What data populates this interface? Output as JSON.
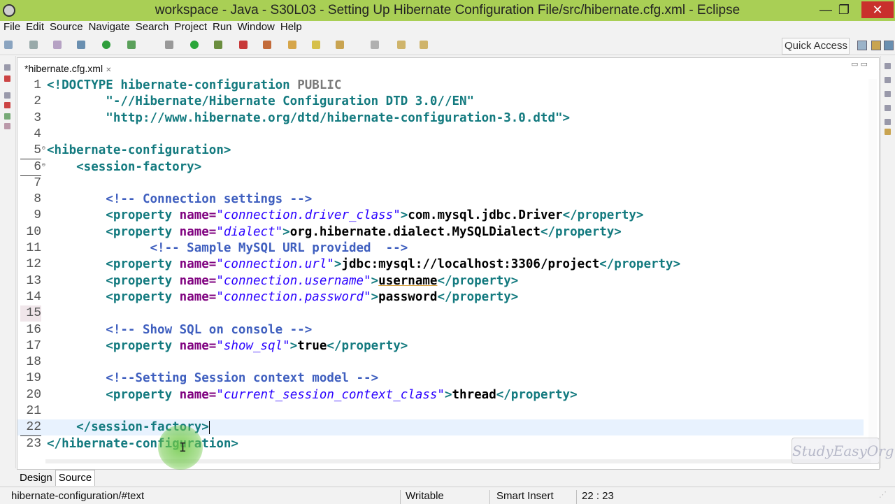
{
  "window": {
    "title": "workspace - Java - S30L03 - Setting Up Hibernate Configuration File/src/hibernate.cfg.xml - Eclipse",
    "minimize": "—",
    "maximize": "❐",
    "close": "✕"
  },
  "menu": [
    "File",
    "Edit",
    "Source",
    "Navigate",
    "Search",
    "Project",
    "Run",
    "Window",
    "Help"
  ],
  "toolbar": {
    "quick_access": "Quick Access"
  },
  "editor": {
    "tab_label": "*hibernate.cfg.xml",
    "tab_close": "✕",
    "min_max": "▭ ▭"
  },
  "lines": [
    {
      "num": "1",
      "t": [
        [
          "c-doc",
          "<!DOCTYPE hibernate-configuration "
        ],
        [
          "c-pub",
          "PUBLIC"
        ]
      ]
    },
    {
      "num": "2",
      "t": [
        [
          "c-str",
          "        \"-//Hibernate/Hibernate Configuration DTD 3.0//EN\""
        ]
      ]
    },
    {
      "num": "3",
      "t": [
        [
          "c-str",
          "        \"http://www.hibernate.org/dtd/hibernate-configuration-3.0.dtd\">"
        ]
      ]
    },
    {
      "num": "4",
      "t": []
    },
    {
      "num": "5",
      "t": [
        [
          "c-tag",
          "<hibernate-configuration>"
        ]
      ]
    },
    {
      "num": "6",
      "t": [
        [
          "c-tag",
          "    <session-factory>"
        ]
      ]
    },
    {
      "num": "7",
      "t": []
    },
    {
      "num": "8",
      "t": [
        [
          "c-com",
          "        <!-- Connection settings -->"
        ]
      ]
    },
    {
      "num": "9",
      "t": [
        [
          "c-tag",
          "        <property "
        ],
        [
          "c-attr",
          "name="
        ],
        [
          "c-val",
          "\"connection.driver_class\""
        ],
        [
          "c-tag",
          ">"
        ],
        [
          "c-text",
          "com.mysql.jdbc.Driver"
        ],
        [
          "c-tag",
          "</property>"
        ]
      ]
    },
    {
      "num": "10",
      "t": [
        [
          "c-tag",
          "        <property "
        ],
        [
          "c-attr",
          "name="
        ],
        [
          "c-val",
          "\"dialect\""
        ],
        [
          "c-tag",
          ">"
        ],
        [
          "c-text",
          "org.hibernate.dialect.MySQLDialect"
        ],
        [
          "c-tag",
          "</property>"
        ]
      ]
    },
    {
      "num": "11",
      "t": [
        [
          "c-com",
          "              <!-- Sample MySQL URL provided  -->"
        ]
      ]
    },
    {
      "num": "12",
      "t": [
        [
          "c-tag",
          "        <property "
        ],
        [
          "c-attr",
          "name="
        ],
        [
          "c-val",
          "\"connection.url\""
        ],
        [
          "c-tag",
          ">"
        ],
        [
          "c-text",
          "jdbc:mysql://localhost:3306/project"
        ],
        [
          "c-tag",
          "</property>"
        ]
      ]
    },
    {
      "num": "13",
      "t": [
        [
          "c-tag",
          "        <property "
        ],
        [
          "c-attr",
          "name="
        ],
        [
          "c-val",
          "\"connection.username\""
        ],
        [
          "c-tag",
          ">"
        ],
        [
          "c-text",
          "username"
        ],
        [
          "c-tag",
          "</property>"
        ]
      ]
    },
    {
      "num": "14",
      "t": [
        [
          "c-tag",
          "        <property "
        ],
        [
          "c-attr",
          "name="
        ],
        [
          "c-val",
          "\"connection.password\""
        ],
        [
          "c-tag",
          ">"
        ],
        [
          "c-text",
          "password"
        ],
        [
          "c-tag",
          "</property>"
        ]
      ]
    },
    {
      "num": "15",
      "t": []
    },
    {
      "num": "16",
      "t": [
        [
          "c-com",
          "        <!-- Show SQL on console -->"
        ]
      ]
    },
    {
      "num": "17",
      "t": [
        [
          "c-tag",
          "        <property "
        ],
        [
          "c-attr",
          "name="
        ],
        [
          "c-val",
          "\"show_sql\""
        ],
        [
          "c-tag",
          ">"
        ],
        [
          "c-text",
          "true"
        ],
        [
          "c-tag",
          "</property>"
        ]
      ]
    },
    {
      "num": "18",
      "t": []
    },
    {
      "num": "19",
      "t": [
        [
          "c-com",
          "        <!--Setting Session context model -->"
        ]
      ]
    },
    {
      "num": "20",
      "t": [
        [
          "c-tag",
          "        <property "
        ],
        [
          "c-attr",
          "name="
        ],
        [
          "c-val",
          "\"current_session_context_class\""
        ],
        [
          "c-tag",
          ">"
        ],
        [
          "c-text",
          "thread"
        ],
        [
          "c-tag",
          "</property>"
        ]
      ]
    },
    {
      "num": "21",
      "t": []
    },
    {
      "num": "22",
      "t": [
        [
          "c-tag",
          "    </session-factory>"
        ]
      ]
    },
    {
      "num": "23",
      "t": [
        [
          "c-tag",
          "</hibernate-configuration>"
        ]
      ]
    }
  ],
  "bottom_tabs": {
    "design": "Design",
    "source": "Source"
  },
  "status": {
    "path": "hibernate-configuration/#text",
    "writable": "Writable",
    "insert_mode": "Smart Insert",
    "position": "22 : 23"
  },
  "watermark": "StudyEasyOrg"
}
